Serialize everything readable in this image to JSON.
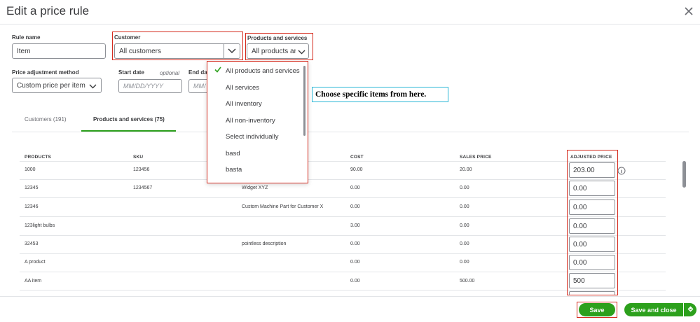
{
  "dialog": {
    "title": "Edit a price rule"
  },
  "form": {
    "rule_name": {
      "label": "Rule name",
      "value": "Item"
    },
    "customer": {
      "label": "Customer",
      "value": "All customers"
    },
    "products": {
      "label": "Products and services",
      "value": "All products ar"
    },
    "price_method": {
      "label": "Price adjustment method",
      "value": "Custom price per item"
    },
    "start_date": {
      "label": "Start date",
      "optional": "optional",
      "placeholder": "MM/DD/YYYY"
    },
    "end_date": {
      "label": "End da",
      "placeholder": "MM/"
    }
  },
  "tabs": [
    {
      "label": "Customers (191)",
      "active": false
    },
    {
      "label": "Products and services (75)",
      "active": true
    }
  ],
  "dropdown_menu": {
    "items": [
      {
        "label": "All products and services",
        "selected": true
      },
      {
        "label": "All services",
        "selected": false
      },
      {
        "label": "All inventory",
        "selected": false
      },
      {
        "label": "All non-inventory",
        "selected": false
      },
      {
        "label": "Select individually",
        "selected": false
      },
      {
        "label": "basd",
        "selected": false
      },
      {
        "label": "basta",
        "selected": false
      }
    ]
  },
  "callout": {
    "text": "Choose specific items from here."
  },
  "table": {
    "headers": {
      "products": "PRODUCTS",
      "sku": "SKU",
      "cost": "COST",
      "sales_price": "SALES PRICE",
      "adjusted_price": "ADJUSTED PRICE"
    },
    "rows": [
      {
        "product": "1000",
        "sku": "123456",
        "description": "",
        "cost": "90.00",
        "sales_price": "20.00",
        "adjusted": "203.00"
      },
      {
        "product": "12345",
        "sku": "1234567",
        "description": "Widget XYZ",
        "cost": "0.00",
        "sales_price": "0.00",
        "adjusted": "0.00"
      },
      {
        "product": "12346",
        "sku": "",
        "description": "Custom Machine Part for Customer X",
        "cost": "0.00",
        "sales_price": "0.00",
        "adjusted": "0.00"
      },
      {
        "product": "123light bulbs",
        "sku": "",
        "description": "",
        "cost": "3.00",
        "sales_price": "0.00",
        "adjusted": "0.00"
      },
      {
        "product": "32453",
        "sku": "",
        "description": "pointless description",
        "cost": "0.00",
        "sales_price": "0.00",
        "adjusted": "0.00"
      },
      {
        "product": "A product",
        "sku": "",
        "description": "",
        "cost": "0.00",
        "sales_price": "0.00",
        "adjusted": "0.00"
      },
      {
        "product": "AA item",
        "sku": "",
        "description": "",
        "cost": "0.00",
        "sales_price": "500.00",
        "adjusted": "500"
      }
    ]
  },
  "footer": {
    "save": "Save",
    "save_close": "Save and close"
  },
  "colors": {
    "brand_green": "#2ca01c",
    "annotation_red": "#d52b1e",
    "annotation_cyan": "#29b6d6"
  }
}
